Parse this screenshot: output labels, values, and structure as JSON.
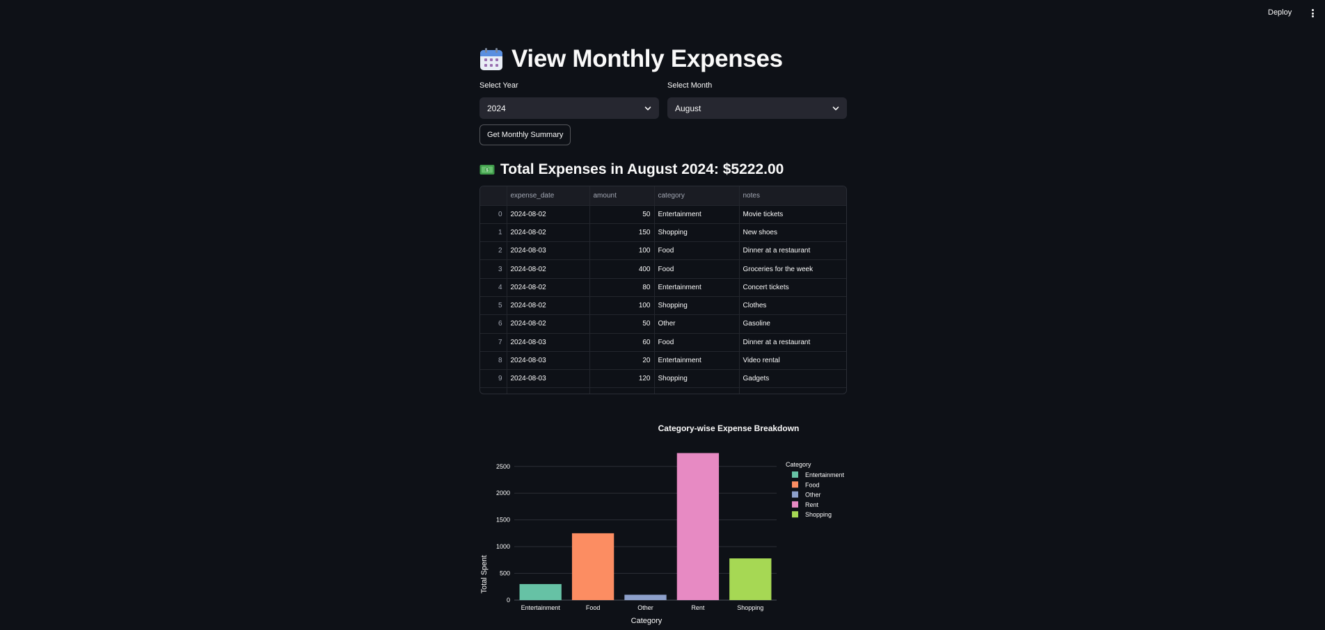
{
  "topbar": {
    "deploy_label": "Deploy",
    "menu_icon": "kebab-menu-icon"
  },
  "page": {
    "title_icon": "calendar-icon",
    "title": "View Monthly Expenses"
  },
  "filters": {
    "year_label": "Select Year",
    "year_value": "2024",
    "month_label": "Select Month",
    "month_value": "August"
  },
  "actions": {
    "summary_button": "Get Monthly Summary"
  },
  "summary": {
    "icon": "money-icon",
    "heading": "Total Expenses in August 2024: $5222.00"
  },
  "table": {
    "columns": [
      "",
      "expense_date",
      "amount",
      "category",
      "notes"
    ],
    "rows": [
      [
        "0",
        "2024-08-02",
        "50",
        "Entertainment",
        "Movie tickets"
      ],
      [
        "1",
        "2024-08-02",
        "150",
        "Shopping",
        "New shoes"
      ],
      [
        "2",
        "2024-08-03",
        "100",
        "Food",
        "Dinner at a restaurant"
      ],
      [
        "3",
        "2024-08-02",
        "400",
        "Food",
        "Groceries for the week"
      ],
      [
        "4",
        "2024-08-02",
        "80",
        "Entertainment",
        "Concert tickets"
      ],
      [
        "5",
        "2024-08-02",
        "100",
        "Shopping",
        "Clothes"
      ],
      [
        "6",
        "2024-08-02",
        "50",
        "Other",
        "Gasoline"
      ],
      [
        "7",
        "2024-08-03",
        "60",
        "Food",
        "Dinner at a restaurant"
      ],
      [
        "8",
        "2024-08-03",
        "20",
        "Entertainment",
        "Video rental"
      ],
      [
        "9",
        "2024-08-03",
        "120",
        "Shopping",
        "Gadgets"
      ]
    ]
  },
  "chart_data": {
    "type": "bar",
    "title": "Category-wise Expense Breakdown",
    "xlabel": "Category",
    "ylabel": "Total Spent",
    "categories": [
      "Entertainment",
      "Food",
      "Other",
      "Rent",
      "Shopping"
    ],
    "values": [
      300,
      1250,
      100,
      2750,
      780
    ],
    "colors": [
      "#66c2a5",
      "#fc8d62",
      "#8da0cb",
      "#e78ac3",
      "#a6d854"
    ],
    "yticks": [
      0,
      500,
      1000,
      1500,
      2000,
      2500
    ],
    "ylim": [
      0,
      2900
    ],
    "grid": true,
    "legend": {
      "title": "Category",
      "placement": "right",
      "entries": [
        "Entertainment",
        "Food",
        "Other",
        "Rent",
        "Shopping"
      ]
    }
  }
}
